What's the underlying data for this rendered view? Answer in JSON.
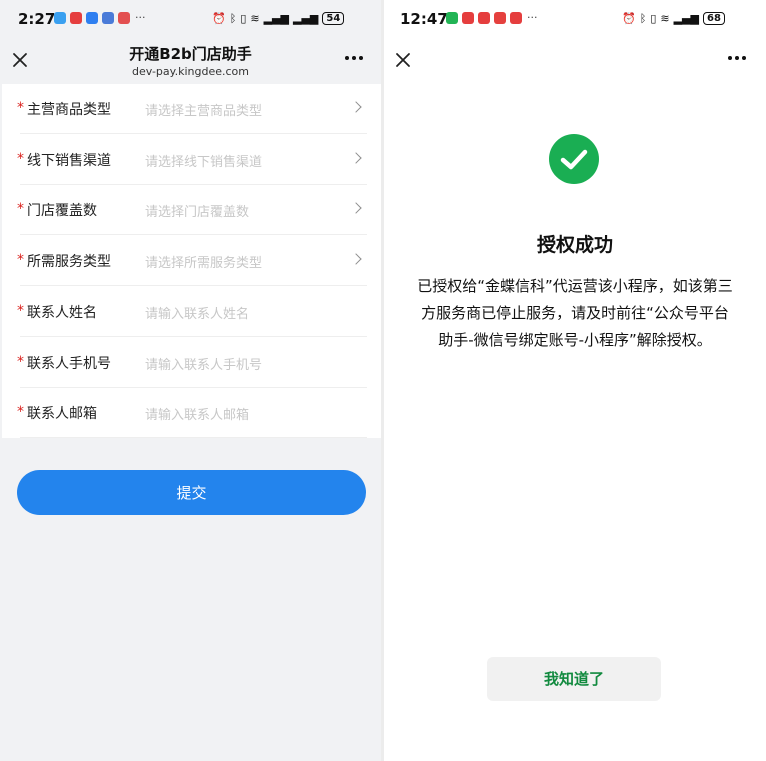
{
  "left": {
    "status": {
      "time": "2:27",
      "more": "···",
      "battery": "54",
      "app_colors": [
        "#3aa0f0",
        "#e53e3e",
        "#2f7ff0",
        "#4a7bd8",
        "#e35050"
      ]
    },
    "nav": {
      "title": "开通B2b门店助手",
      "subtitle": "dev-pay.kingdee.com"
    },
    "form": {
      "required_mark": "*",
      "rows": [
        {
          "label": "主营商品类型",
          "placeholder": "请选择主营商品类型",
          "type": "select"
        },
        {
          "label": "线下销售渠道",
          "placeholder": "请选择线下销售渠道",
          "type": "select"
        },
        {
          "label": "门店覆盖数",
          "placeholder": "请选择门店覆盖数",
          "type": "select"
        },
        {
          "label": "所需服务类型",
          "placeholder": "请选择所需服务类型",
          "type": "select"
        },
        {
          "label": "联系人姓名",
          "placeholder": "请输入联系人姓名",
          "type": "input"
        },
        {
          "label": "联系人手机号",
          "placeholder": "请输入联系人手机号",
          "type": "input"
        },
        {
          "label": "联系人邮箱",
          "placeholder": "请输入联系人邮箱",
          "type": "input"
        }
      ]
    },
    "submit_label": "提交"
  },
  "right": {
    "status": {
      "time": "12:47",
      "more": "···",
      "battery": "68",
      "app_colors": [
        "#22b455",
        "#e53e3e",
        "#e53e3e",
        "#e5413e",
        "#e53e3e"
      ]
    },
    "success": {
      "title": "授权成功",
      "message": "已授权给“金蝶信科”代运营该小程序，如该第三方服务商已停止服务，请及时前往“公众号平台助手-微信号绑定账号-小程序”解除授权。"
    },
    "ok_label": "我知道了"
  },
  "icons": {
    "close": "close-icon",
    "more": "more-icon",
    "chevron": "chevron-right-icon",
    "check": "check-icon",
    "alarm": "alarm-icon",
    "bluetooth": "bluetooth-icon",
    "vibrate": "vibrate-icon",
    "wifi": "wifi-icon",
    "signal": "signal-icon"
  },
  "colors": {
    "primary": "#2384ed",
    "required": "#d9211d",
    "success": "#1aae53",
    "ok_text": "#128a3f"
  }
}
